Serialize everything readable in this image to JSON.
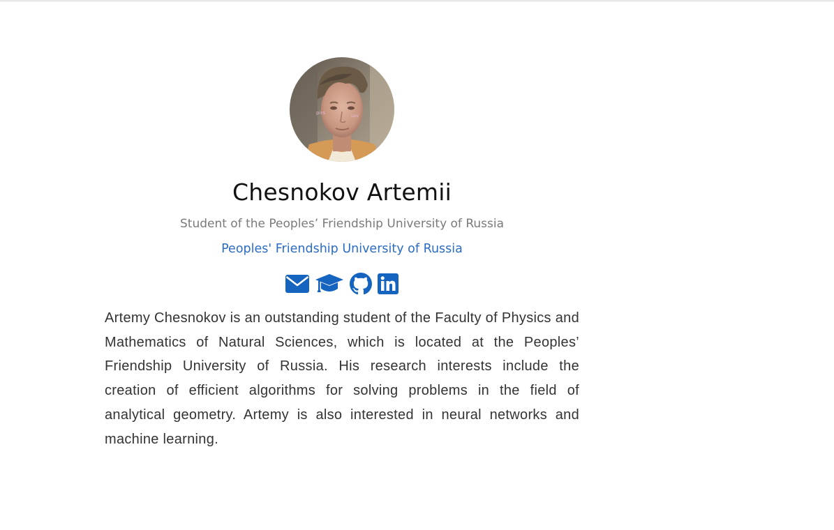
{
  "profile": {
    "avatar_alt": "avatar",
    "name": "Chesnokov Artemii",
    "position": "Student of the Peoples’ Friendship University of Russia",
    "affiliation": "Peoples' Friendship University of Russia",
    "bio": "Artemy Chesnokov is an outstanding student of the Faculty of Physics and Mathematics of Natural Sciences, which is located at the Peoples’ Friendship University of Russia. His research interests include the creation of efficient algorithms for solving problems in the field of analytical geometry. Artemy is also interested in neural networks and machine learning."
  },
  "socials": [
    {
      "icon": "envelope-icon",
      "label": "Email"
    },
    {
      "icon": "graduation-cap-icon",
      "label": "Google Scholar"
    },
    {
      "icon": "github-icon",
      "label": "GitHub"
    },
    {
      "icon": "linkedin-icon",
      "label": "LinkedIn"
    }
  ],
  "colors": {
    "link": "#2b6cc4",
    "icon": "#1565c0",
    "subtitle": "#7a7a7a",
    "text": "#333333"
  }
}
